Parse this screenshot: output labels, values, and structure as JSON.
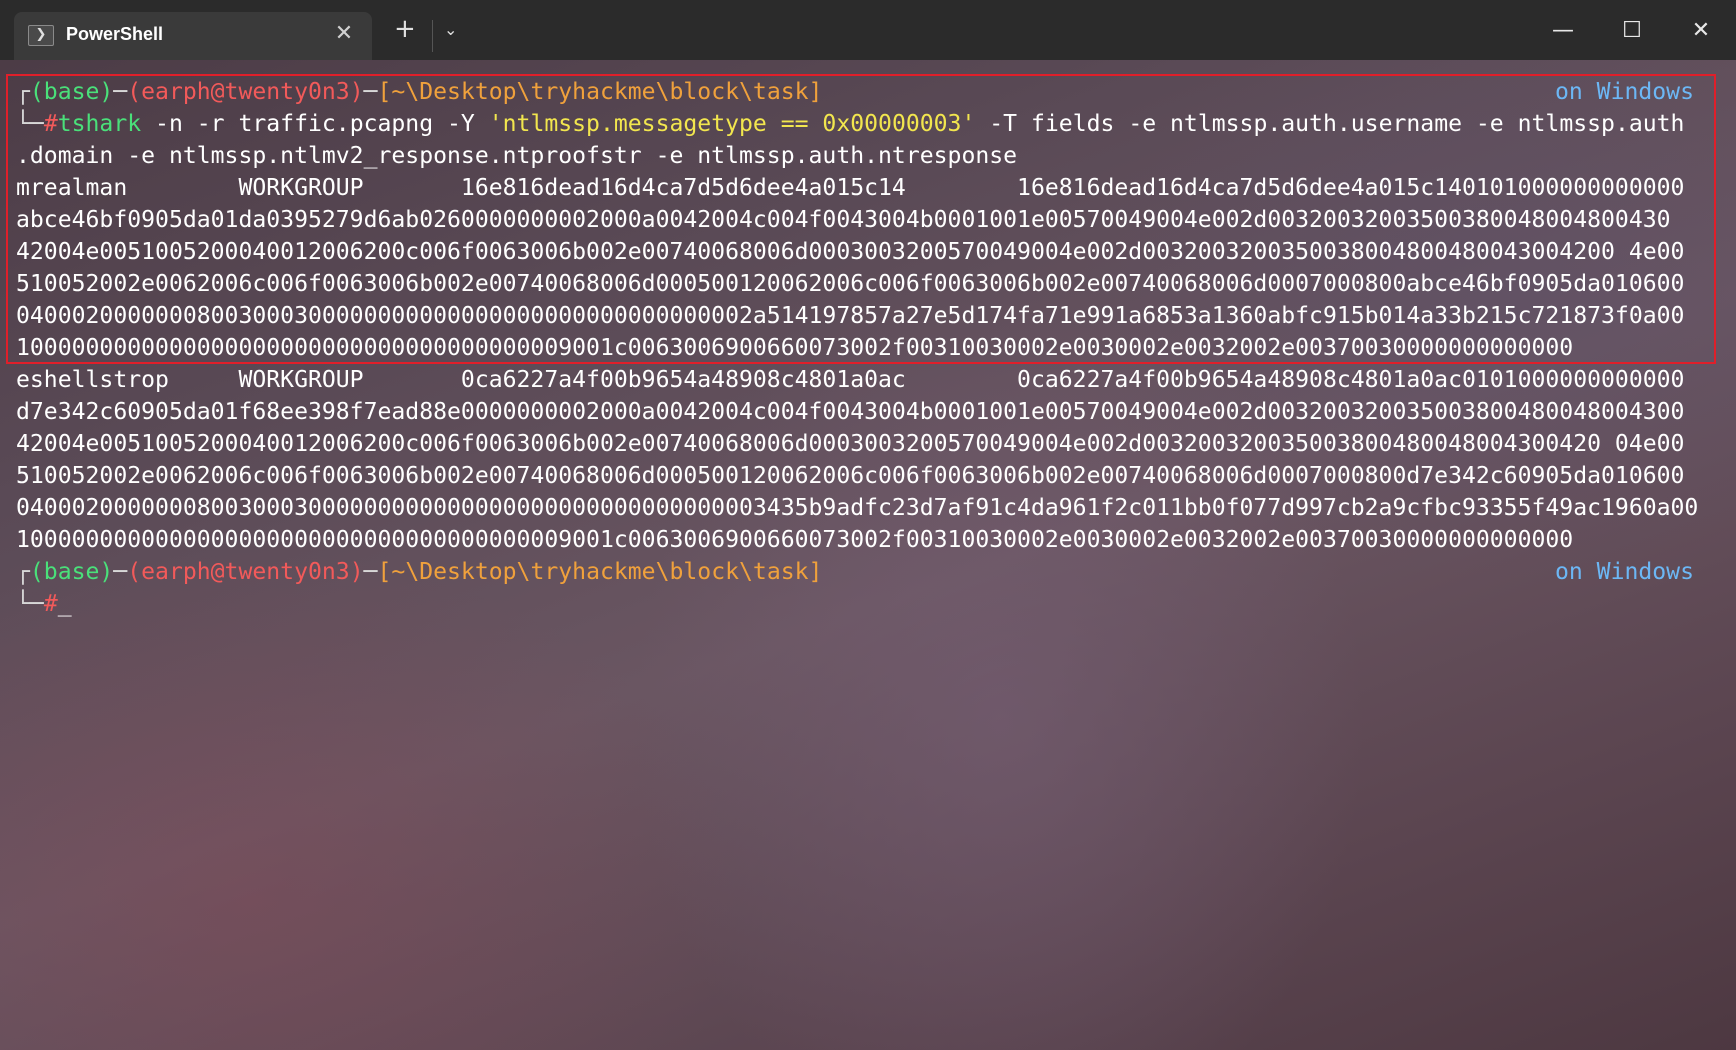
{
  "window": {
    "tab_title": "PowerShell",
    "tab_icon": "powershell-icon",
    "tab_close": "✕",
    "new_tab": "+",
    "dropdown": "⌄",
    "minimize": "—",
    "maximize": "☐",
    "close": "✕"
  },
  "prompt1": {
    "corner": "┌",
    "base": "(base)",
    "dash": "─",
    "user": "(earph@twenty0n3)",
    "dash2": "─",
    "path": "[~\\Desktop\\tryhackme\\block\\task]",
    "right": "on Windows",
    "corner2": "└─",
    "hash": "#",
    "cmd": "tshark",
    "args1": " -n -r traffic.pcapng -Y ",
    "filter": "'ntlmssp.messagetype == 0x00000003'",
    "args2": " -T fields -e ntlmssp.auth.username -e ntlmssp.auth",
    "args3": ".domain -e ntlmssp.ntlmv2_response.ntproofstr -e ntlmssp.auth.ntresponse"
  },
  "output": [
    "mrealman        WORKGROUP       16e816dead16d4ca7d5d6dee4a015c14        16e816dead16d4ca7d5d6dee4a015c140101000000000000",
    "abce46bf0905da01da0395279d6ab0260000000002000a0042004c004f0043004b0001001e00570049004e002d00320032003500380048004800430",
    "42004e0051005200040012006200c006f0063006b002e00740068006d0003003200570049004e002d0032003200350038004800480043004200 4e00",
    "510052002e0062006c006f0063006b002e00740068006d000500120062006c006f0063006b002e00740068006d0007000800abce46bf0905da010600",
    "04000200000008003000300000000000000000000000000000002a514197857a27e5d174fa71e991a6853a1360abfc915b014a33b215c721873f0a00",
    "1000000000000000000000000000000000000009001c0063006900660073002f00310030002e0030002e0032002e00370030000000000000",
    "eshellstrop     WORKGROUP       0ca6227a4f00b9654a48908c4801a0ac        0ca6227a4f00b9654a48908c4801a0ac0101000000000000",
    "d7e342c60905da01f68ee398f7ead88e0000000002000a0042004c004f0043004b0001001e00570049004e002d003200320035003800480048004300",
    "42004e0051005200040012006200c006f0063006b002e00740068006d0003003200570049004e002d003200320035003800480048004300420 04e00",
    "510052002e0062006c006f0063006b002e00740068006d000500120062006c006f0063006b002e00740068006d0007000800d7e342c60905da010600",
    "040002000000080030003000000000000000000000000000000003435b9adfc23d7af91c4da961f2c011bb0f077d997cb2a9cfbc93355f49ac1960a00",
    "1000000000000000000000000000000000000009001c0063006900660073002f00310030002e0030002e0032002e00370030000000000000"
  ],
  "prompt2": {
    "corner": "┌",
    "base": "(base)",
    "dash": "─",
    "user": "(earph@twenty0n3)",
    "dash2": "─",
    "path": "[~\\Desktop\\tryhackme\\block\\task]",
    "right": "on Windows",
    "corner2": "└─",
    "hash": "#",
    "cursor": "_"
  }
}
